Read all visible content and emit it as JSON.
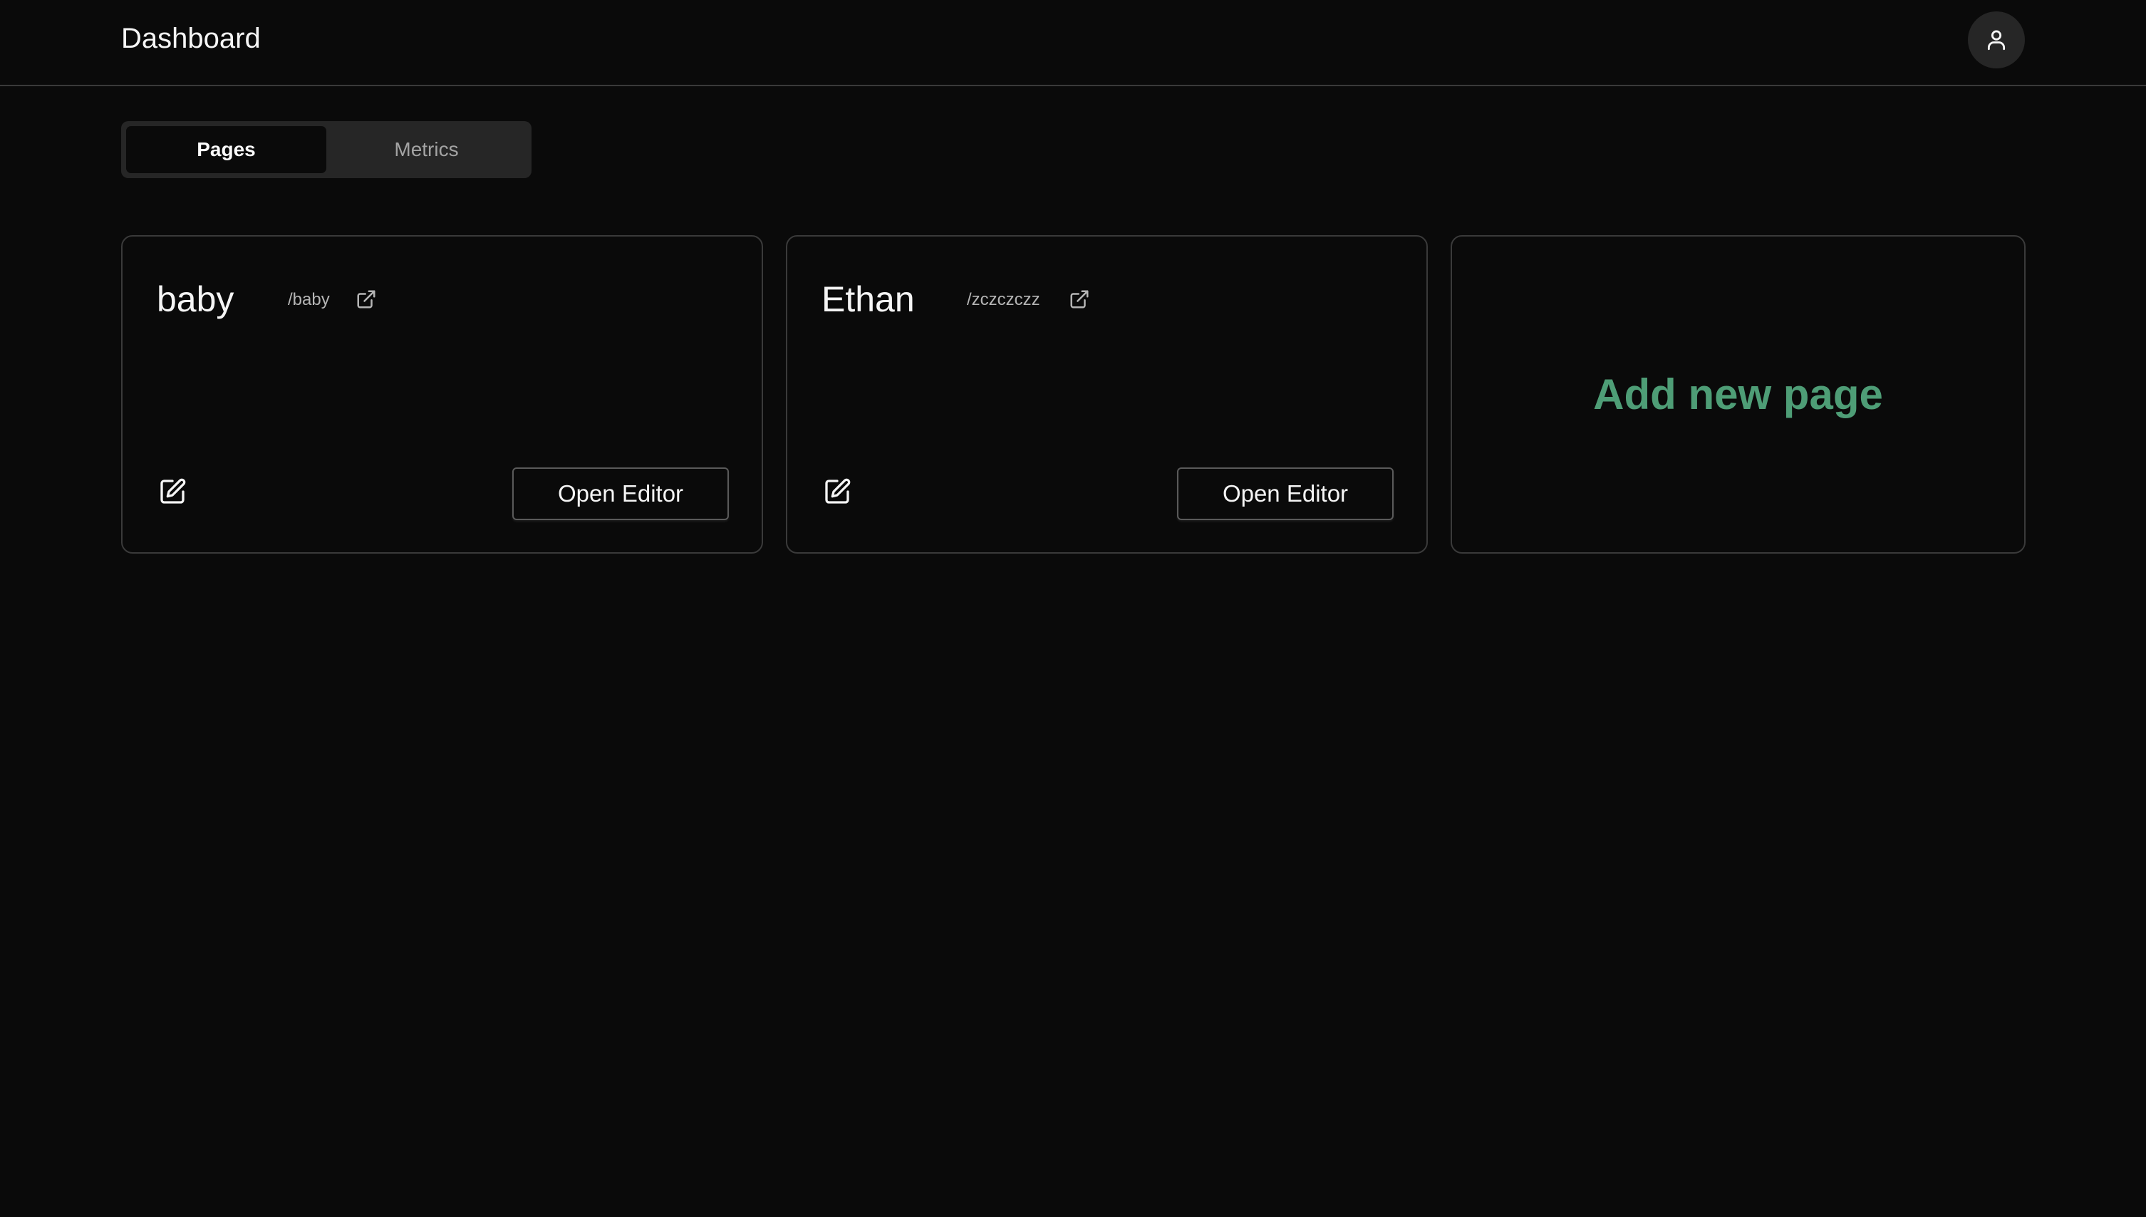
{
  "header": {
    "title": "Dashboard",
    "avatar_icon": "user-icon"
  },
  "tabs": [
    {
      "label": "Pages",
      "active": true
    },
    {
      "label": "Metrics",
      "active": false
    }
  ],
  "pages": [
    {
      "name": "baby",
      "slug": "/baby",
      "open_label": "Open Editor"
    },
    {
      "name": "Ethan",
      "slug": "/zczczczz",
      "open_label": "Open Editor"
    }
  ],
  "add_card": {
    "label": "Add new page"
  },
  "colors": {
    "background": "#0a0a0a",
    "border": "#3a3a3a",
    "accent_green": "#4e9d76",
    "tab_bg": "#262626"
  },
  "icons": {
    "external": "external-link-icon",
    "edit": "edit-icon"
  }
}
